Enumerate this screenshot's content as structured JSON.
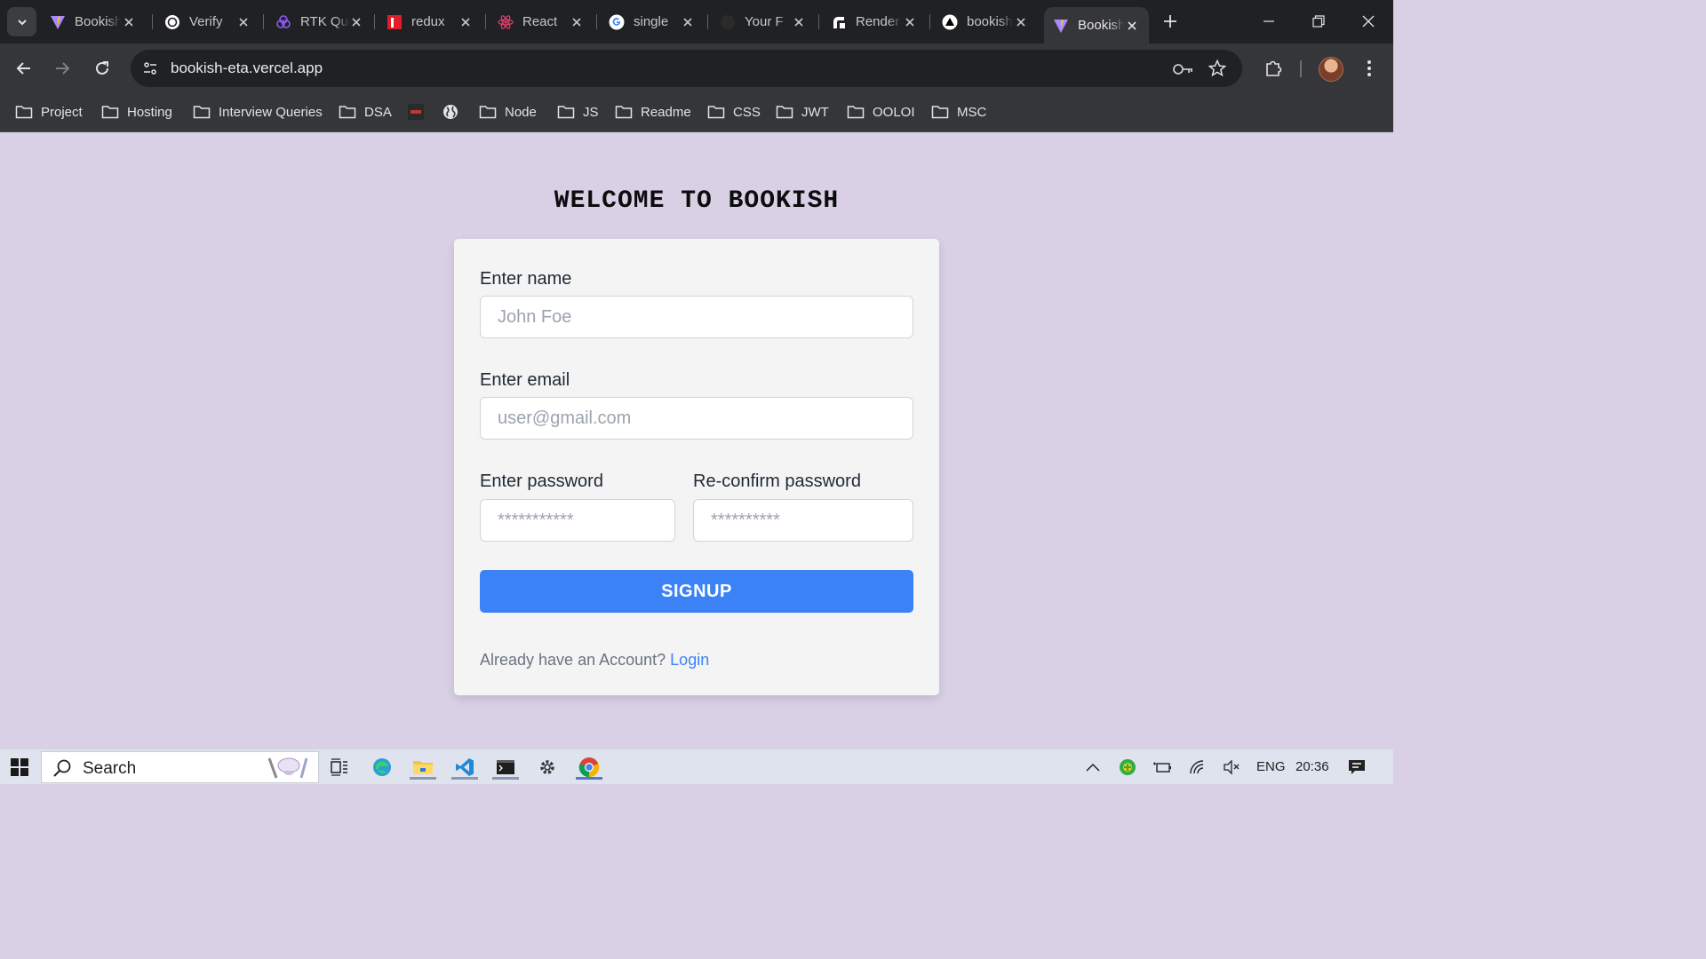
{
  "browser": {
    "tabs": [
      {
        "title": "Bookish",
        "icon": "vite-icon"
      },
      {
        "title": "Verify",
        "icon": "openai-icon"
      },
      {
        "title": "RTK Query",
        "icon": "rtk-icon"
      },
      {
        "title": "redux",
        "icon": "redux-red-icon"
      },
      {
        "title": "React",
        "icon": "react-icon"
      },
      {
        "title": "single",
        "icon": "google-icon"
      },
      {
        "title": "Your F",
        "icon": "github-icon"
      },
      {
        "title": "Render",
        "icon": "render-icon"
      },
      {
        "title": "bookish",
        "icon": "vercel-icon"
      },
      {
        "title": "Bookish",
        "icon": "vite-icon",
        "active": true
      }
    ],
    "url": "bookish-eta.vercel.app",
    "bookmarks": [
      {
        "label": "Project",
        "type": "folder"
      },
      {
        "label": "Hosting",
        "type": "folder"
      },
      {
        "label": "Interview Queries",
        "type": "folder"
      },
      {
        "label": "DSA",
        "type": "folder"
      },
      {
        "label": "",
        "type": "site-icon"
      },
      {
        "label": "",
        "type": "globe-icon"
      },
      {
        "label": "Node",
        "type": "folder"
      },
      {
        "label": "JS",
        "type": "folder"
      },
      {
        "label": "Readme",
        "type": "folder"
      },
      {
        "label": "CSS",
        "type": "folder"
      },
      {
        "label": "JWT",
        "type": "folder"
      },
      {
        "label": "OOLOI",
        "type": "folder"
      },
      {
        "label": "MSC",
        "type": "folder"
      }
    ]
  },
  "page": {
    "heading": "WELCOME TO BOOKISH",
    "form": {
      "name_label": "Enter name",
      "name_placeholder": "John Foe",
      "email_label": "Enter email",
      "email_placeholder": "user@gmail.com",
      "password_label": "Enter password",
      "password_placeholder": "***********",
      "confirm_label": "Re-confirm password",
      "confirm_placeholder": "**********",
      "signup_label": "SIGNUP",
      "already_text": "Already have an Account?",
      "login_link": "Login"
    },
    "colors": {
      "background": "#d9d0e6",
      "card": "#f4f4f5",
      "accent": "#3b82f6"
    }
  },
  "taskbar": {
    "search_label": "Search",
    "language": "ENG",
    "time": "20:36"
  }
}
